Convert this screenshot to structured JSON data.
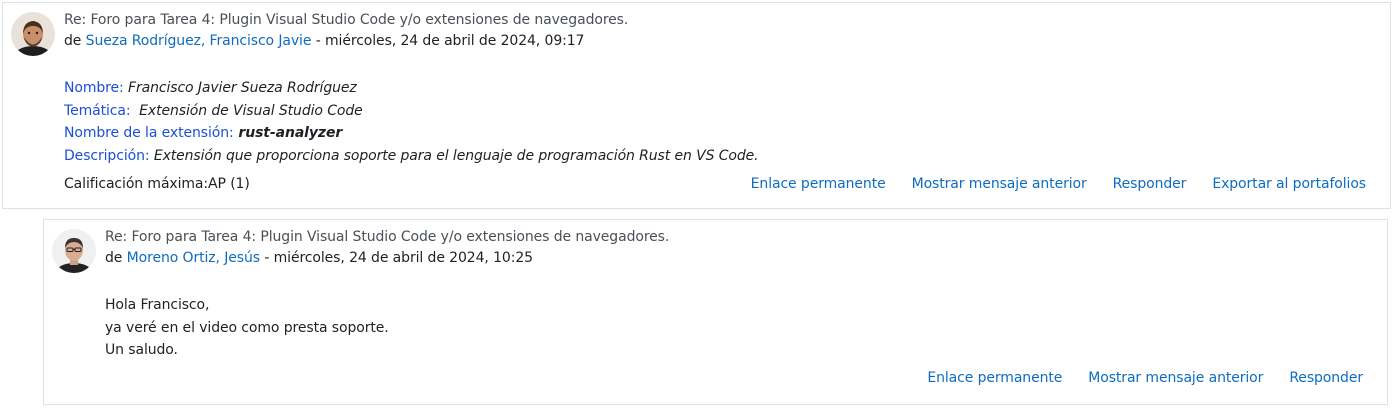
{
  "posts": [
    {
      "subject": "Re: Foro para Tarea 4: Plugin Visual Studio Code y/o extensiones de navegadores.",
      "by_prefix": "de ",
      "author": "Sueza Rodríguez, Francisco Javie",
      "date": " - miércoles, 24 de abril de 2024, 09:17",
      "fields": [
        {
          "label": "Nombre:",
          "value": " Francisco Javier Sueza Rodríguez"
        },
        {
          "label": "Temática:",
          "value": "  Extensión de Visual Studio Code"
        },
        {
          "label": "Nombre de la extensión:",
          "value": " rust-analyzer"
        },
        {
          "label": "Descripción:",
          "value": " Extensión que proporciona soporte para el lenguaje de programación Rust en VS Code."
        }
      ],
      "rating": "Calificación máxima:AP (1)",
      "actions": [
        "Enlace permanente",
        "Mostrar mensaje anterior",
        "Responder",
        "Exportar al portafolios"
      ]
    },
    {
      "subject": "Re: Foro para Tarea 4: Plugin Visual Studio Code y/o extensiones de navegadores.",
      "by_prefix": "de ",
      "author": "Moreno Ortiz, Jesús",
      "date": " - miércoles, 24 de abril de 2024, 10:25",
      "lines": [
        "Hola Francisco,",
        "ya veré en el video como presta soporte.",
        "Un saludo."
      ],
      "actions": [
        "Enlace permanente",
        "Mostrar mensaje anterior",
        "Responder"
      ]
    }
  ]
}
